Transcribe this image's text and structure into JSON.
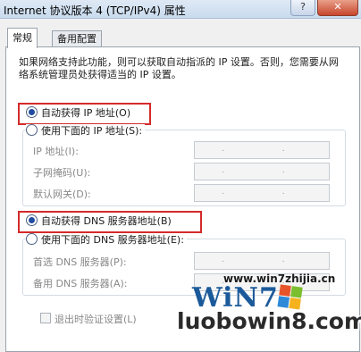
{
  "window": {
    "title": "Internet 协议版本 4 (TCP/IPv4) 属性",
    "help_label": "?",
    "close_label": "✕"
  },
  "tabs": [
    {
      "label": "常规",
      "active": true
    },
    {
      "label": "备用配置",
      "active": false
    }
  ],
  "description": "如果网络支持此功能，则可以获取自动指派的 IP 设置。否则，您需要从网络系统管理员处获得适当的 IP 设置。",
  "ip": {
    "auto_label": "自动获得 IP 地址(O)",
    "manual_label": "使用下面的 IP 地址(S):",
    "selected": "auto",
    "fields": [
      {
        "label": "IP 地址(I):",
        "value": ". . ."
      },
      {
        "label": "子网掩码(U):",
        "value": ". . ."
      },
      {
        "label": "默认网关(D):",
        "value": ". . ."
      }
    ]
  },
  "dns": {
    "auto_label": "自动获得 DNS 服务器地址(B)",
    "manual_label": "使用下面的 DNS 服务器地址(E):",
    "selected": "auto",
    "fields": [
      {
        "label": "首选 DNS 服务器(P):",
        "value": ". . ."
      },
      {
        "label": "备用 DNS 服务器(A):",
        "value": ". . ."
      }
    ]
  },
  "validate_on_exit": {
    "label": "退出时验证设置(L)",
    "checked": false
  },
  "watermark": {
    "url": "www.win7zhijia.cn",
    "logo": "WiN7",
    "site": "luobowin8.com",
    "flag_colors": [
      "#e8542a",
      "#7bbf2f",
      "#2d8ad8",
      "#f5b21f"
    ]
  },
  "colors": {
    "highlight": "#d42a2a",
    "title_bar": "#c9dbee"
  }
}
